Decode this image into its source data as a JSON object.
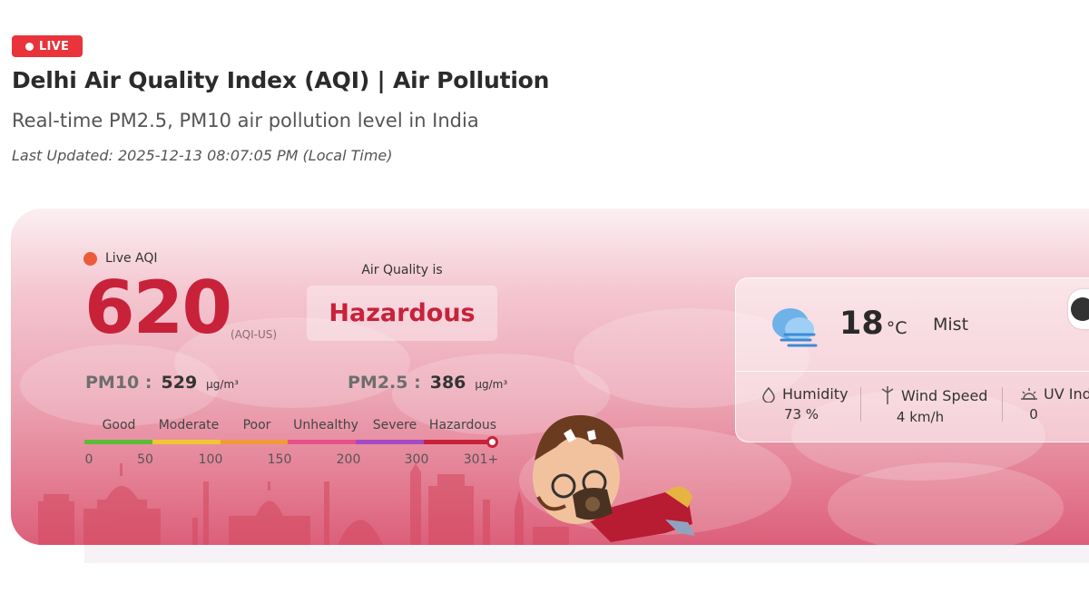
{
  "badge": {
    "label": "LIVE"
  },
  "header": {
    "title": "Delhi Air Quality Index (AQI) | Air Pollution",
    "subtitle": "Real-time PM2.5, PM10 air pollution level in India",
    "last_updated": "Last Updated: 2025-12-13 08:07:05 PM (Local Time)"
  },
  "aqi": {
    "live_label": "Live AQI",
    "value": "620",
    "unit": "(AQI-US)",
    "quality_label": "Air Quality is",
    "status": "Hazardous",
    "status_color": "#c8223b"
  },
  "pollutants": {
    "pm10": {
      "label": "PM10 :",
      "value": "529",
      "unit": "µg/m³"
    },
    "pm25": {
      "label": "PM2.5 :",
      "value": "386",
      "unit": "µg/m³"
    }
  },
  "scale": {
    "categories": [
      "Good",
      "Moderate",
      "Poor",
      "Unhealthy",
      "Severe",
      "Hazardous"
    ],
    "colors": [
      "#5dbb3a",
      "#f1c533",
      "#f29a3a",
      "#e8508a",
      "#a44ac4",
      "#c8223b"
    ],
    "ticks": [
      "0",
      "50",
      "100",
      "150",
      "200",
      "300",
      "301+"
    ]
  },
  "weather": {
    "icon": "mist-cloud-icon",
    "temperature": "18",
    "temperature_unit": "°C",
    "condition": "Mist",
    "humidity": {
      "label": "Humidity",
      "value": "73 %"
    },
    "wind": {
      "label": "Wind Speed",
      "value": "4 km/h"
    },
    "uv": {
      "label": "UV Ind",
      "value": "0"
    }
  }
}
